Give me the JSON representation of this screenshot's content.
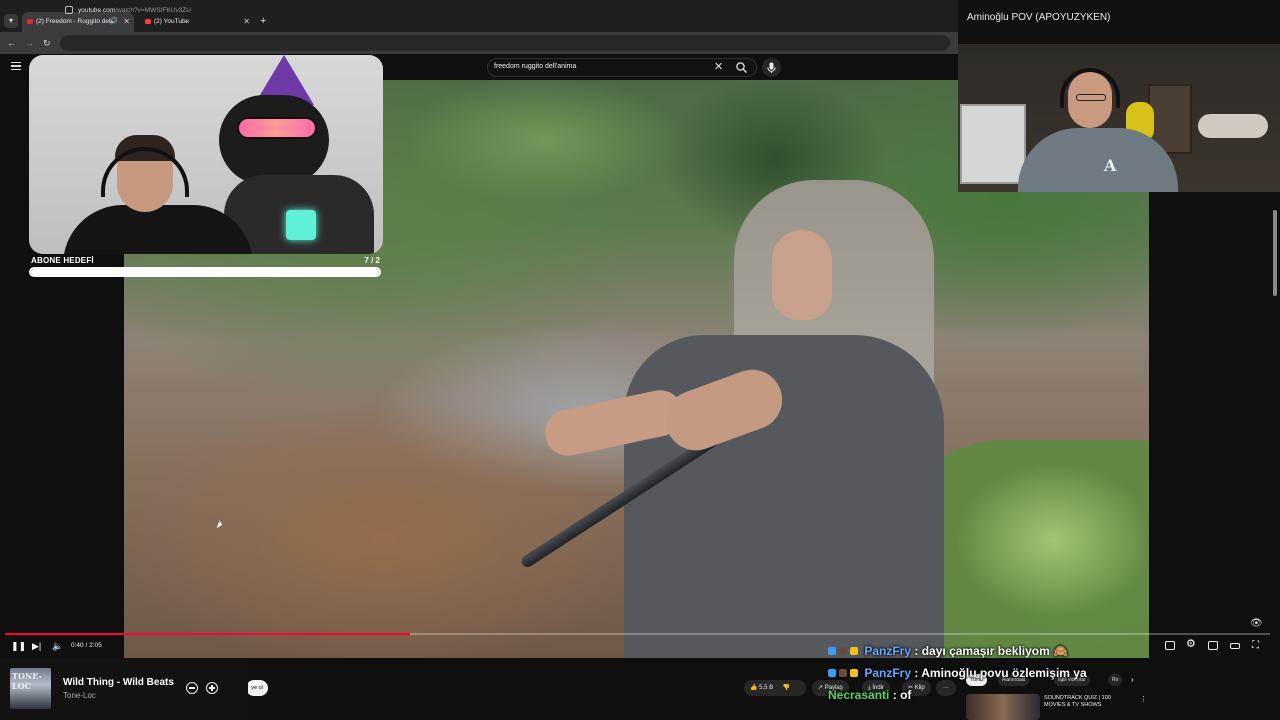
{
  "browser": {
    "tabs": [
      {
        "title": "(2) Freedom - Ruggito dell'",
        "active": true
      },
      {
        "title": "(2) YouTube",
        "active": false
      }
    ],
    "url_host": "youtube.com",
    "url_path": "/watch?v=MWSIFKUv3ZU"
  },
  "youtube": {
    "search_query": "freedom ruggito dell'anima",
    "player": {
      "current_time": "0:40 / 2:05",
      "progress_fraction": 0.32
    },
    "actions": {
      "likes": "5,5 B",
      "share": "Paylaş",
      "download": "İndir",
      "clip": "Klip",
      "subscribe": "ye ol"
    },
    "recommendations": {
      "chips": [
        "Tümü",
        "Alanındaki",
        "İlgili videolar",
        "Ro"
      ],
      "first_title": "SOUNDTRACK QUIZ | 100 MOVIES & TV SHOWS"
    }
  },
  "overlay": {
    "sub_goal_label": "ABONE HEDEFİ",
    "sub_goal_count": "7 / 2",
    "sub_goal_fraction": 1.0,
    "cam_right_title": "Aminoğlu POV (APOYUZYKEN)",
    "chat": [
      {
        "nick": "PanzFry",
        "sep": ":",
        "msg": "dayı çamaşır bekliyom 🙈"
      },
      {
        "nick": "PanzFry",
        "sep": ":",
        "msg": "Aminoğlu povu özlemişim ya"
      },
      {
        "nick": "Necrasanti",
        "sep": ":",
        "msg": "of"
      }
    ]
  },
  "mini_player": {
    "art_label": "TONE-LOC",
    "title": "Wild Thing - Wild Beats",
    "artist": "Tone-Loc"
  },
  "colors": {
    "accent_red": "#ff0033",
    "chat_nick_blue": "#6aa5ff",
    "chat_nick_green": "#5fd06c"
  }
}
